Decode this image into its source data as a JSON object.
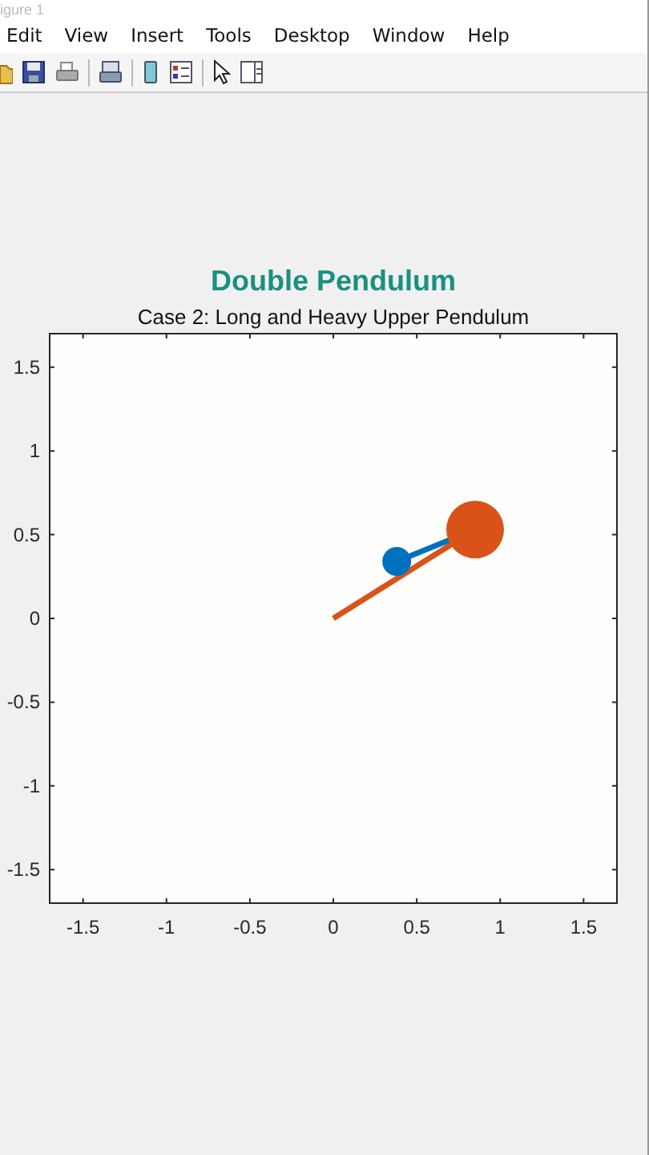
{
  "window": {
    "title": "igure 1"
  },
  "menu": [
    "Edit",
    "View",
    "Insert",
    "Tools",
    "Desktop",
    "Window",
    "Help"
  ],
  "figure": {
    "title": "Double Pendulum",
    "subtitle": "Case 2: Long and Heavy Upper Pendulum",
    "chart_data": {
      "type": "scatter",
      "xlim": [
        -1.7,
        1.7
      ],
      "ylim": [
        -1.7,
        1.7
      ],
      "xticks": [
        -1.5,
        -1,
        -0.5,
        0,
        0.5,
        1,
        1.5
      ],
      "yticks": [
        -1.5,
        -1,
        -0.5,
        0,
        0.5,
        1,
        1.5
      ],
      "series": [
        {
          "color": "#d95319",
          "x": [
            0.85
          ],
          "values": [
            0.53
          ]
        },
        {
          "color": "#0072bd",
          "x": [
            0.38
          ],
          "values": [
            0.34
          ]
        }
      ]
    }
  }
}
